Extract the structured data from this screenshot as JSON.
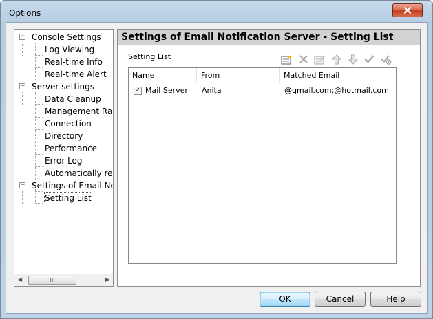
{
  "window": {
    "title": "Options"
  },
  "tree": {
    "items": [
      {
        "label": "Console Settings",
        "level": 0,
        "expanded": true
      },
      {
        "label": "Log Viewing",
        "level": 1
      },
      {
        "label": "Real-time Info",
        "level": 1
      },
      {
        "label": "Real-time Alert",
        "level": 1
      },
      {
        "label": "Server settings",
        "level": 0,
        "expanded": true
      },
      {
        "label": "Data Cleanup",
        "level": 1
      },
      {
        "label": "Management Rang",
        "level": 1
      },
      {
        "label": "Connection",
        "level": 1
      },
      {
        "label": "Directory",
        "level": 1
      },
      {
        "label": "Performance",
        "level": 1
      },
      {
        "label": "Error Log",
        "level": 1
      },
      {
        "label": "Automatically rem",
        "level": 1
      },
      {
        "label": "Settings of Email Notif",
        "level": 0,
        "expanded": true
      },
      {
        "label": "Setting List",
        "level": 1,
        "selected": true
      }
    ],
    "scroll_thumb_glyph": "III"
  },
  "panel": {
    "title": "Settings of Email Notification Server - Setting List",
    "group_label": "Setting List",
    "toolbar": [
      "new-icon",
      "delete-icon",
      "edit-icon",
      "move-up-icon",
      "move-down-icon",
      "enable-check-icon",
      "disable-check-icon"
    ],
    "columns": [
      "Name",
      "From",
      "Matched Email"
    ],
    "rows": [
      {
        "checked": true,
        "name": "Mail Server",
        "from": "Anita",
        "matched_email": "@gmail.com;@hotmail.com"
      }
    ]
  },
  "buttons": {
    "ok": "OK",
    "cancel": "Cancel",
    "help": "Help"
  }
}
